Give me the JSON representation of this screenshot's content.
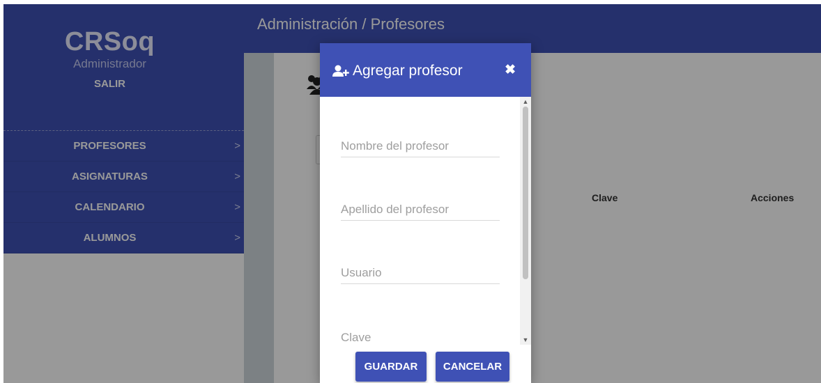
{
  "sidebar": {
    "brand": "CRSoq",
    "role": "Administrador",
    "logout": "SALIR",
    "items": [
      {
        "label": "PROFESORES"
      },
      {
        "label": "ASIGNATURAS"
      },
      {
        "label": "CALENDARIO"
      },
      {
        "label": "ALUMNOS"
      }
    ],
    "chevron": ">"
  },
  "header": {
    "breadcrumb": "Administración / Profesores"
  },
  "table": {
    "columns": [
      "Clave",
      "Acciones"
    ]
  },
  "modal": {
    "title": "Agregar profesor",
    "close_glyph": "✖",
    "fields": [
      {
        "placeholder": "Nombre del profesor",
        "value": ""
      },
      {
        "placeholder": "Apellido del profesor",
        "value": ""
      },
      {
        "placeholder": "Usuario",
        "value": ""
      },
      {
        "placeholder": "Clave",
        "value": ""
      }
    ],
    "save_label": "GUARDAR",
    "cancel_label": "CANCELAR"
  },
  "colors": {
    "primary": "#3f51b5",
    "overlay": "rgba(0,0,0,0.40)",
    "white": "#ffffff"
  },
  "icons": {
    "modal_title": "user-plus-icon",
    "page_header": "users-icon",
    "close": "close-icon",
    "menu_chevron": "chevron-right-icon"
  }
}
